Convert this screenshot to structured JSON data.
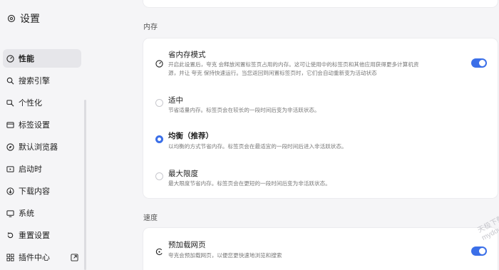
{
  "app": {
    "title": "设置"
  },
  "sidebar": {
    "items": [
      {
        "label": "性能",
        "icon": "gauge-icon",
        "active": true
      },
      {
        "label": "搜索引擎",
        "icon": "search-icon"
      },
      {
        "label": "个性化",
        "icon": "brush-icon"
      },
      {
        "label": "标签设置",
        "icon": "tab-icon"
      },
      {
        "label": "默认浏览器",
        "icon": "compass-icon"
      },
      {
        "label": "启动时",
        "icon": "startup-icon"
      },
      {
        "label": "下载内容",
        "icon": "download-icon"
      },
      {
        "label": "系统",
        "icon": "monitor-icon"
      },
      {
        "label": "重置设置",
        "icon": "reset-icon"
      },
      {
        "label": "插件中心",
        "icon": "plugin-icon"
      }
    ]
  },
  "memory": {
    "section_label": "内存",
    "saver": {
      "title": "省内存模式",
      "desc_line1": "开启此设置后，夸克 会释放闲置标签页占用的内存。这可让使用中的标签页和其他应用获得更多计算机资",
      "desc_line2": "源，并让 夸克 保持快速运行。当您返回到闲置标签页时，它们会自动重新变为活动状态",
      "enabled": true
    },
    "options": [
      {
        "title": "适中",
        "desc": "节省适量内存。标签页会在较长的一段时间后变为非活跃状态。",
        "checked": false
      },
      {
        "title": "均衡（推荐）",
        "desc": "以均衡的方式节省内存。标签页会在最适宜的一段时间后进入非活跃状态。",
        "checked": true
      },
      {
        "title": "最大限度",
        "desc": "最大限度节省内存。标签页会在更短的一段时间后变为非活跃状态。",
        "checked": false
      }
    ]
  },
  "speed": {
    "section_label": "速度",
    "preload": {
      "title": "预加载网页",
      "desc": "夸克会预加载网页，以便您更快速地浏览和搜索",
      "enabled": true
    }
  },
  "watermark": {
    "line1": "天极下载站",
    "line2": "mydown.yesky.com"
  },
  "colors": {
    "accent": "#3b6fe8",
    "background": "#f5f5f7",
    "card": "#ffffff"
  }
}
